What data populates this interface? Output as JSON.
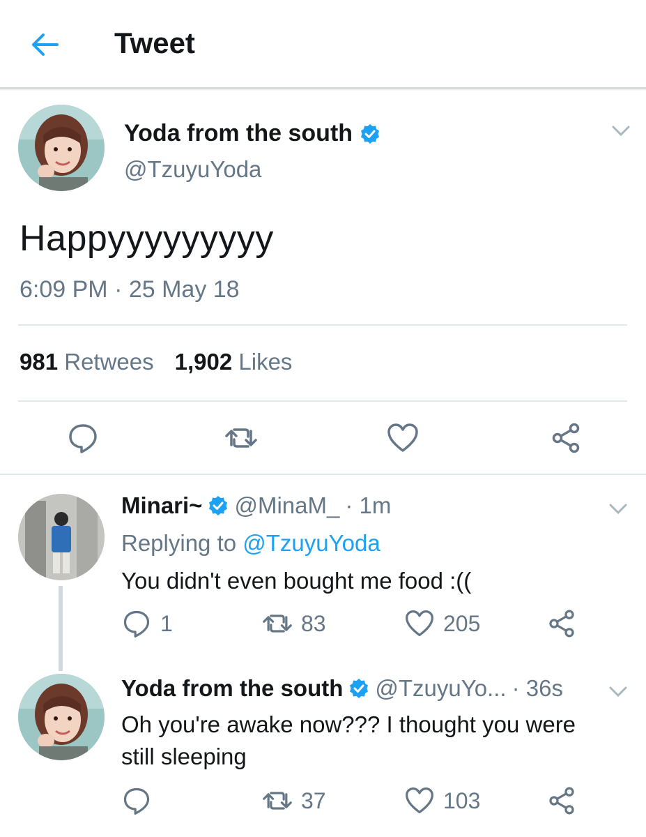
{
  "header": {
    "title": "Tweet",
    "back_icon": "back-arrow-icon"
  },
  "main_tweet": {
    "name": "Yoda from the south",
    "handle": "@TzuyuYoda",
    "text": "Happyyyyyyyyy",
    "timestamp": "6:09 PM · 25 May 18",
    "retweets_count": "981",
    "retweets_label": "Retwees",
    "likes_count": "1,902",
    "likes_label": "Likes"
  },
  "replies": [
    {
      "name": "Minari~",
      "handle": "@MinaM_",
      "time": "· 1m",
      "replying_prefix": "Replying to ",
      "replying_to": "@TzuyuYoda",
      "text": "You didn't even bought me food :((",
      "reply_count": "1",
      "retweet_count": "83",
      "like_count": "205"
    },
    {
      "name": "Yoda from the south",
      "handle": "@TzuyuYo...",
      "time": "· 36s",
      "text_line1": "Oh you're awake now??? I thought you were",
      "text_line2": "still sleeping",
      "reply_count": "",
      "retweet_count": "37",
      "like_count": "103"
    }
  ],
  "colors": {
    "accent": "#1da1f2",
    "secondary_text": "#657786",
    "primary_text": "#14171a",
    "divider": "#e1e8ed"
  }
}
